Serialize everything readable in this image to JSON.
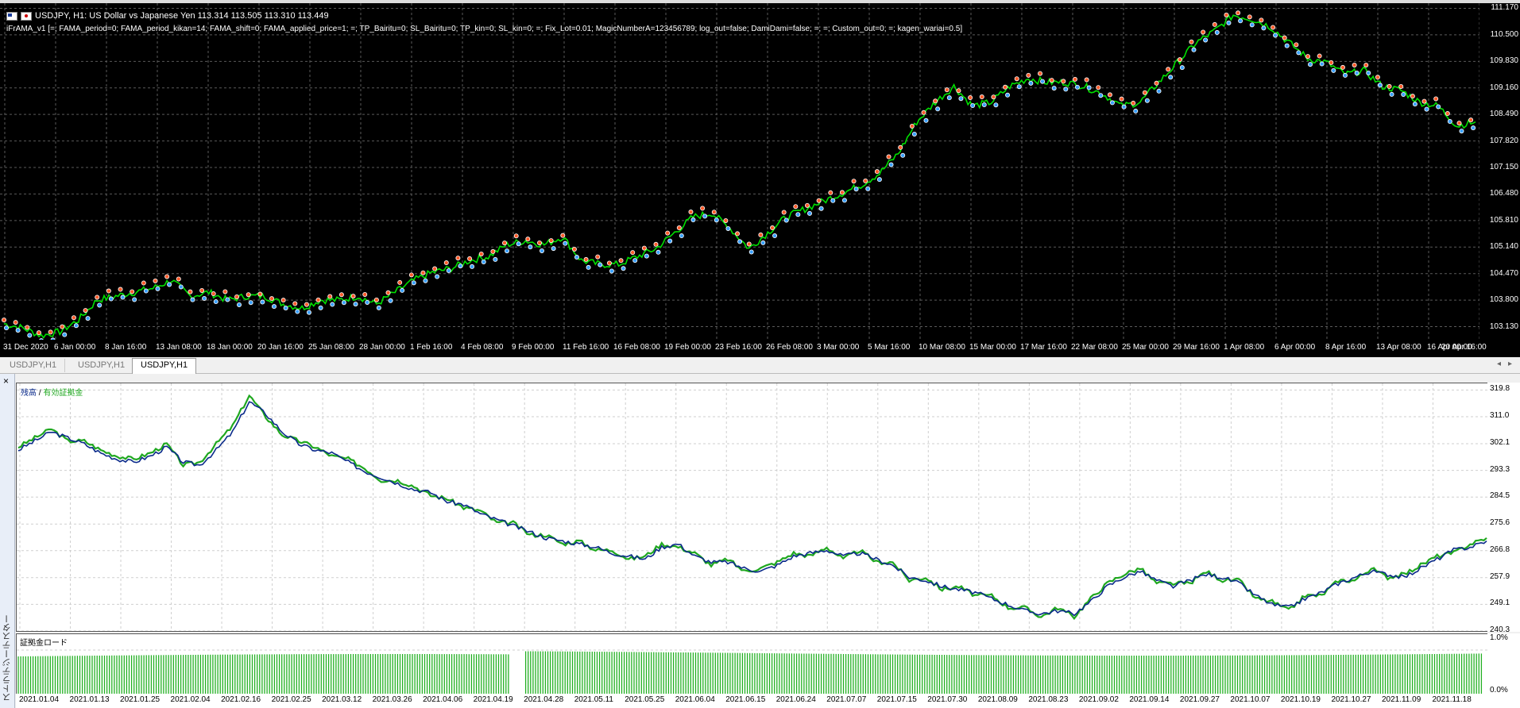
{
  "window": {
    "symbol_title": "USDJPY, H1:  US Dollar vs Japanese Yen  113.314 113.505 113.310 113.449",
    "indicator_params": "iFrAMA_v1 [=; FAMA_period=0; FAMA_period_kikan=14; FAMA_shift=0; FAMA_applied_price=1; =; TP_Bairitu=0; SL_Bairitu=0; TP_kin=0; SL_kin=0; =; Fix_Lot=0.01; MagicNumberA=123456789; log_out=false; DamiDami=false; =; =; Custom_out=0; =; kagen_wariai=0.5]"
  },
  "price_axis": [
    "111.170",
    "110.500",
    "109.830",
    "109.160",
    "108.490",
    "107.820",
    "107.150",
    "106.480",
    "105.810",
    "105.140",
    "104.470",
    "103.800",
    "103.130"
  ],
  "time_axis": [
    "31 Dec 2020",
    "6 Jan 00:00",
    "8 Jan 16:00",
    "13 Jan 08:00",
    "18 Jan 00:00",
    "20 Jan 16:00",
    "25 Jan 08:00",
    "28 Jan 00:00",
    "1 Feb 16:00",
    "4 Feb 08:00",
    "9 Feb 00:00",
    "11 Feb 16:00",
    "16 Feb 08:00",
    "19 Feb 00:00",
    "23 Feb 16:00",
    "26 Feb 08:00",
    "3 Mar 00:00",
    "5 Mar 16:00",
    "10 Mar 08:00",
    "15 Mar 00:00",
    "17 Mar 16:00",
    "22 Mar 08:00",
    "25 Mar 00:00",
    "29 Mar 16:00",
    "1 Apr 08:00",
    "6 Apr 00:00",
    "8 Apr 16:00",
    "13 Apr 08:00",
    "16 Apr 00:00",
    "20 Apr 16:00"
  ],
  "tabs": [
    {
      "label": "USDJPY,H1",
      "active": false
    },
    {
      "label": "USDJPY,H1",
      "active": false
    },
    {
      "label": "USDJPY,H1",
      "active": true
    }
  ],
  "tester": {
    "side_title": "ストラテジーテスター",
    "close_symbol": "×",
    "legend_balance": "残高",
    "legend_sep": " / ",
    "legend_equity": "有効証拠金",
    "margin_title": "証拠金ロード",
    "balance_axis": [
      "319.8",
      "311.0",
      "302.1",
      "293.3",
      "284.5",
      "275.6",
      "266.8",
      "257.9",
      "249.1",
      "240.3"
    ],
    "margin_axis": [
      "1.0%",
      "0.0%"
    ],
    "date_axis": [
      "2021.01.04",
      "2021.01.13",
      "2021.01.25",
      "2021.02.04",
      "2021.02.16",
      "2021.02.25",
      "2021.03.12",
      "2021.03.26",
      "2021.04.06",
      "2021.04.19",
      "2021.04.28",
      "2021.05.11",
      "2021.05.25",
      "2021.06.04",
      "2021.06.15",
      "2021.06.24",
      "2021.07.07",
      "2021.07.15",
      "2021.07.30",
      "2021.08.09",
      "2021.08.23",
      "2021.09.02",
      "2021.09.14",
      "2021.09.27",
      "2021.10.07",
      "2021.10.19",
      "2021.10.27",
      "2021.11.09",
      "2021.11.18"
    ]
  },
  "colors": {
    "price_line": "#00e000",
    "balance_line": "#0a2a8a",
    "equity_line": "#1fa81f",
    "margin_bar": "#22b022",
    "grid": "#5a5a5a"
  },
  "chart_data": [
    {
      "type": "line",
      "title": "USDJPY, H1",
      "ylim": [
        102.8,
        111.3
      ],
      "x_start": "31 Dec 2020",
      "x_end": "20 Apr 16:00",
      "series": [
        {
          "values": [
            103.2,
            103.1,
            102.9,
            103.0,
            103.3,
            103.8,
            103.9,
            104.0,
            104.1,
            104.3,
            103.9,
            104.0,
            103.8,
            103.9,
            103.9,
            103.7,
            103.6,
            103.8,
            103.8,
            103.9,
            103.7,
            104.0,
            104.3,
            104.5,
            104.6,
            104.8,
            104.9,
            105.2,
            105.3,
            105.2,
            105.4,
            104.8,
            104.7,
            104.7,
            104.9,
            105.1,
            105.5,
            105.9,
            106.0,
            105.6,
            105.1,
            105.5,
            105.9,
            106.1,
            106.3,
            106.5,
            106.7,
            107.0,
            107.5,
            108.3,
            108.8,
            109.2,
            108.7,
            108.8,
            109.2,
            109.4,
            109.3,
            109.3,
            109.2,
            109.0,
            108.7,
            108.8,
            109.3,
            109.8,
            110.3,
            110.6,
            111.0,
            110.9,
            110.7,
            110.3,
            109.9,
            109.8,
            109.5,
            109.6,
            109.2,
            109.1,
            108.8,
            108.7,
            108.2,
            108.3
          ]
        }
      ]
    },
    {
      "type": "line",
      "title": "残高 / 有効証拠金",
      "ylim": [
        240.3,
        322.0
      ],
      "x_start": "2021.01.04",
      "x_end": "2021.11.18",
      "series": [
        {
          "name": "残高",
          "values": [
            300,
            303,
            306,
            304,
            302,
            299,
            297,
            296,
            298,
            301,
            296,
            295,
            300,
            306,
            316,
            312,
            306,
            302,
            300,
            299,
            296,
            293,
            291,
            289,
            287,
            286,
            283,
            282,
            279,
            277,
            275,
            273,
            271,
            270,
            269,
            268,
            266,
            265,
            264,
            268,
            269,
            265,
            263,
            263,
            261,
            260,
            262,
            265,
            266,
            267,
            265,
            266,
            264,
            262,
            258,
            257,
            255,
            254,
            253,
            251,
            249,
            247,
            246,
            247,
            246,
            250,
            255,
            258,
            260,
            257,
            255,
            257,
            259,
            258,
            256,
            252,
            249,
            248,
            251,
            253,
            256,
            258,
            260,
            259,
            258,
            261,
            264,
            267,
            268,
            270
          ]
        },
        {
          "name": "有効証拠金",
          "values": [
            301,
            304,
            307,
            303,
            303,
            300,
            298,
            297,
            299,
            302,
            295,
            296,
            302,
            308,
            318,
            311,
            305,
            303,
            301,
            298,
            297,
            294,
            290,
            290,
            288,
            285,
            284,
            281,
            280,
            276,
            276,
            272,
            272,
            269,
            270,
            267,
            267,
            264,
            265,
            269,
            268,
            266,
            262,
            264,
            260,
            261,
            263,
            266,
            265,
            268,
            264,
            267,
            263,
            263,
            257,
            258,
            254,
            255,
            252,
            252,
            248,
            248,
            245,
            248,
            245,
            251,
            256,
            259,
            261,
            256,
            256,
            256,
            260,
            257,
            257,
            251,
            250,
            247,
            252,
            252,
            257,
            257,
            261,
            258,
            259,
            262,
            265,
            266,
            269,
            271
          ]
        }
      ]
    },
    {
      "type": "bar",
      "title": "証拠金ロード",
      "ylim": [
        0.0,
        1.0
      ],
      "values_note": "each bar approx 0.65%-0.78%"
    }
  ]
}
